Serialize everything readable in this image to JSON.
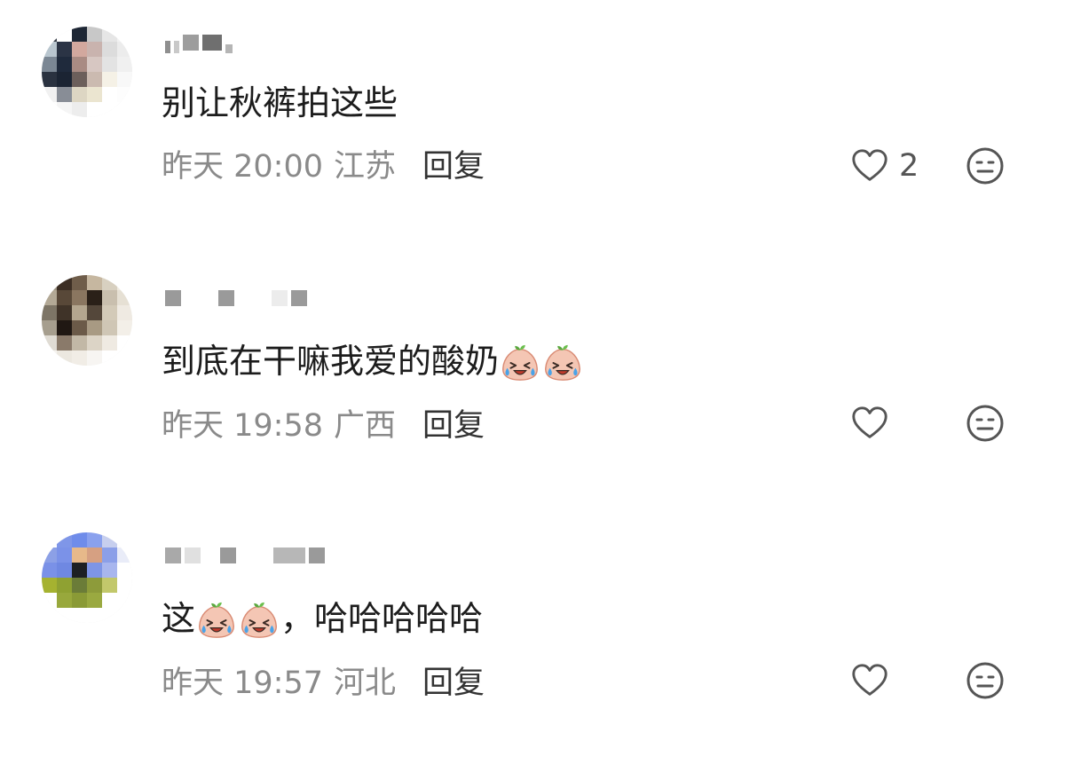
{
  "comments": [
    {
      "content_text": "别让秋裤拍这些",
      "content_suffix": "",
      "emoji_count": 0,
      "time": "昨天 20:00",
      "location": "江苏",
      "reply_label": "回复",
      "like_count": "2",
      "avatar_colors": [
        "#3a3f4a",
        "#ffffff",
        "#1e2735",
        "#c8c8c8",
        "#e6e6e6",
        "#f2f2f2",
        "#b9c6cf",
        "#2b3445",
        "#d2a89e",
        "#c9b3ae",
        "#dcdcdc",
        "#ececec",
        "#7b8794",
        "#1f2a3c",
        "#a98b83",
        "#d7c7c2",
        "#e3e3e3",
        "#f0f0f0",
        "#2a3240",
        "#1b2433",
        "#6c5f5b",
        "#cbbab0",
        "#f5f1e6",
        "#f8f8f8",
        "#f1f1f1",
        "#888d96",
        "#ddd6c3",
        "#ebe5d0",
        "#ffffff",
        "#fdfdfd",
        "#ffffff",
        "#f5f5f5",
        "#ededed",
        "#ffffff",
        "#ffffff",
        "#ffffff"
      ]
    },
    {
      "content_text": "到底在干嘛我爱的酸奶",
      "content_suffix": "",
      "emoji_count": 2,
      "time": "昨天 19:58",
      "location": "广西",
      "reply_label": "回复",
      "like_count": "",
      "avatar_colors": [
        "#9c9384",
        "#3c2e24",
        "#6f5d4a",
        "#c6b7a0",
        "#d8d0c0",
        "#efeae0",
        "#b3a996",
        "#584838",
        "#8a7660",
        "#2a2018",
        "#c9bfae",
        "#e6e0d4",
        "#7d7566",
        "#3f3328",
        "#b4a68f",
        "#54473a",
        "#d3cab8",
        "#efeae2",
        "#a69e8e",
        "#201813",
        "#6b5a48",
        "#a89a83",
        "#cfc6b5",
        "#f3efe8",
        "#e0dcd4",
        "#8a7a6a",
        "#c2b8a6",
        "#dcd4c6",
        "#efeae2",
        "#ffffff",
        "#f6f4f0",
        "#ece8e0",
        "#f1ede6",
        "#f7f5f2",
        "#ffffff",
        "#ffffff"
      ]
    },
    {
      "content_text": "这",
      "content_suffix": "，哈哈哈哈哈",
      "emoji_count": 2,
      "time": "昨天 19:57",
      "location": "河北",
      "reply_label": "回复",
      "like_count": "",
      "avatar_colors": [
        "#ffffff",
        "#7f96e8",
        "#6f8cea",
        "#8aa1ee",
        "#c7cfee",
        "#ffffff",
        "#8ca0e6",
        "#7b92e8",
        "#e7b98a",
        "#d6a082",
        "#8b9fe8",
        "#e9ecf8",
        "#7a91e7",
        "#6f88e2",
        "#1d2024",
        "#7e95e6",
        "#a8b6ee",
        "#ffffff",
        "#a5b230",
        "#8fa132",
        "#6b7c38",
        "#8d9b3a",
        "#c2c86b",
        "#ffffff",
        "#ffffff",
        "#98a83c",
        "#8a9a36",
        "#9aa940",
        "#ffffff",
        "#ffffff",
        "#ffffff",
        "#ffffff",
        "#ffffff",
        "#ffffff",
        "#ffffff",
        "#ffffff"
      ]
    }
  ],
  "icons": {
    "like": "heart-outline-icon",
    "dislike": "neutral-face-icon",
    "emoji": "crying-laughing-peach-emoji"
  },
  "colors": {
    "meta_text": "#8a8a8a",
    "reply_text": "#333333",
    "icon_stroke": "#555555"
  }
}
